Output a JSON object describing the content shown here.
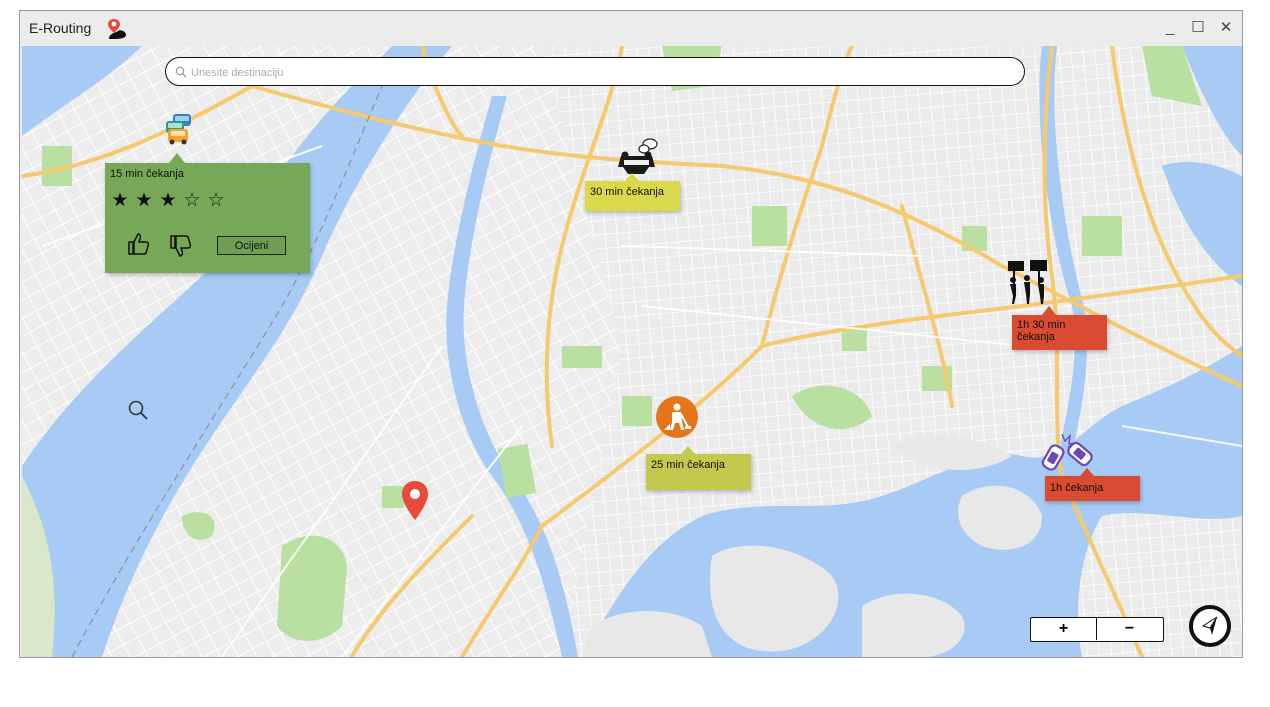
{
  "window": {
    "title": "E-Routing",
    "controls": {
      "minimize": "_",
      "maximize": "☐",
      "close": "✕"
    }
  },
  "search": {
    "placeholder": "Unesite destinaciju",
    "value": ""
  },
  "rating_popup": {
    "wait_text": "15 min čekanja",
    "stars_filled": 3,
    "stars_total": 5,
    "stars": [
      "★",
      "★",
      "★",
      "☆",
      "☆"
    ],
    "rate_button": "Ocijeni"
  },
  "incidents": {
    "accident_cart": {
      "wait_text": "30 min čekanja",
      "color": "#d9d94b",
      "icon": "overturned-car-icon"
    },
    "road_works": {
      "wait_text": "25 min čekanja",
      "color": "#c3c84f",
      "icon": "road-works-icon"
    },
    "protest": {
      "wait_text": "1h 30 min čekanja",
      "color": "#d94b32",
      "icon": "protest-icon"
    },
    "collision": {
      "wait_text": "1h čekanja",
      "color": "#d94b32",
      "icon": "car-collision-icon"
    },
    "traffic_jam": {
      "icon": "traffic-jam-icon"
    }
  },
  "zoom": {
    "in": "+",
    "out": "−"
  },
  "colors": {
    "water": "#a7cbf5",
    "park": "#b9dfa1",
    "highway": "#f6c96f",
    "pin": "#e64b3c",
    "road_works": "#e4751c"
  }
}
